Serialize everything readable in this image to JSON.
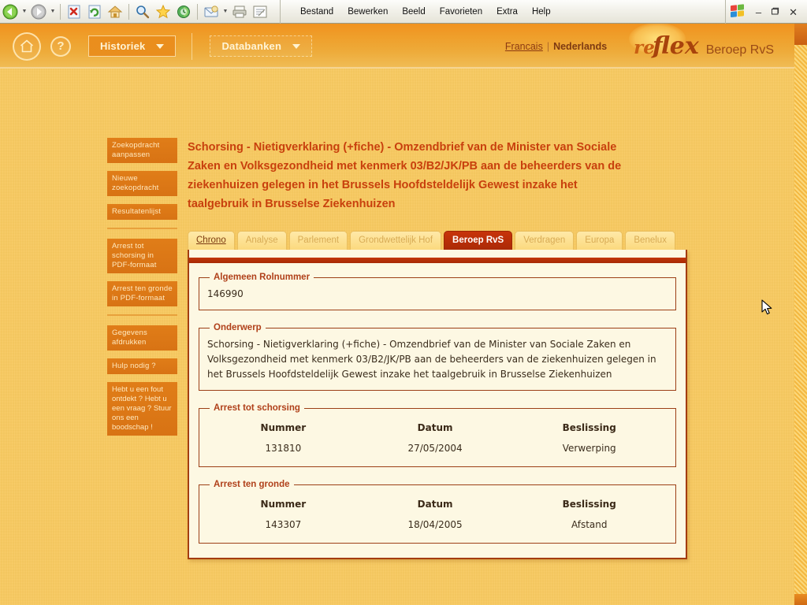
{
  "browser": {
    "toolbar_buttons": [
      {
        "name": "back-button",
        "icon": "back-arrow-icon",
        "label": "Back"
      },
      {
        "name": "forward-button",
        "icon": "forward-arrow-icon",
        "label": "Forward"
      },
      {
        "name": "stop-button",
        "icon": "stop-icon",
        "label": "Stop"
      },
      {
        "name": "refresh-button",
        "icon": "refresh-icon",
        "label": "Refresh"
      },
      {
        "name": "home-button",
        "icon": "house-icon",
        "label": "Home"
      },
      {
        "name": "search-button",
        "icon": "magnifier-icon",
        "label": "Search"
      },
      {
        "name": "favorites-button",
        "icon": "star-icon",
        "label": "Favorites"
      },
      {
        "name": "history-button",
        "icon": "globe-clock-icon",
        "label": "History"
      },
      {
        "name": "mail-button",
        "icon": "envelope-icon",
        "label": "Mail"
      },
      {
        "name": "print-button",
        "icon": "printer-icon",
        "label": "Print"
      },
      {
        "name": "edit-button",
        "icon": "document-edit-icon",
        "label": "Edit"
      }
    ],
    "menu": [
      "Bestand",
      "Bewerken",
      "Beeld",
      "Favorieten",
      "Extra",
      "Help"
    ],
    "window_controls": {
      "minimize": "–",
      "restore": "❐",
      "close": "✕"
    }
  },
  "header": {
    "home_label": "Home",
    "help_label": "?",
    "buttons": [
      {
        "label": "Historiek",
        "name": "historiek-dropdown"
      },
      {
        "label": "Databanken",
        "name": "databanken-dropdown"
      }
    ],
    "languages": {
      "other": "Francais",
      "separator": "|",
      "current": "Nederlands"
    },
    "brand": {
      "part1": "re",
      "part2": "flex",
      "subtitle": "Beroep RvS"
    }
  },
  "sidebar": {
    "items": [
      {
        "label": "Zoekopdracht aanpassen",
        "name": "sidebar-item-adjust-search"
      },
      {
        "label": "Nieuwe zoekopdracht",
        "name": "sidebar-item-new-search"
      },
      {
        "label": "Resultatenlijst",
        "name": "sidebar-item-results-list"
      }
    ],
    "pdf_items": [
      {
        "label": "Arrest tot schorsing in PDF-formaat",
        "name": "sidebar-item-pdf-suspension"
      },
      {
        "label": "Arrest ten gronde in PDF-formaat",
        "name": "sidebar-item-pdf-merits"
      }
    ],
    "tools": [
      {
        "label": "Gegevens afdrukken",
        "name": "sidebar-item-print-data"
      },
      {
        "label": "Hulp nodig ?",
        "name": "sidebar-item-help"
      }
    ],
    "message_box": "Hebt u een fout ontdekt ? Hebt u een vraag ? Stuur ons een boodschap !"
  },
  "main": {
    "page_title": "Schorsing - Nietigverklaring (+fiche) - Omzendbrief van de Minister van Sociale Zaken en Volksgezondheid met kenmerk 03/B2/JK/PB aan de beheerders van de ziekenhuizen gelegen in het Brussels Hoofdsteldelijk Gewest inzake het taalgebruik in Brusselse Ziekenhuizen",
    "tabs": [
      {
        "label": "Chrono",
        "active": false,
        "style": "chrono"
      },
      {
        "label": "Analyse",
        "active": false,
        "style": "dim"
      },
      {
        "label": "Parlement",
        "active": false,
        "style": "dim"
      },
      {
        "label": "Grondwettelijk Hof",
        "active": false,
        "style": "dim"
      },
      {
        "label": "Beroep RvS",
        "active": true,
        "style": "active"
      },
      {
        "label": "Verdragen",
        "active": false,
        "style": "dim"
      },
      {
        "label": "Europa",
        "active": false,
        "style": "dim"
      },
      {
        "label": "Benelux",
        "active": false,
        "style": "dim"
      }
    ],
    "rolnummer": {
      "legend": "Algemeen Rolnummer",
      "value": "146990"
    },
    "onderwerp": {
      "legend": "Onderwerp",
      "value": "Schorsing - Nietigverklaring (+fiche) - Omzendbrief van de Minister van Sociale Zaken en Volksgezondheid met kenmerk 03/B2/JK/PB aan de beheerders van de ziekenhuizen gelegen in het Brussels Hoofdsteldelijk Gewest inzake het taalgebruik in Brusselse Ziekenhuizen"
    },
    "arrest_schorsing": {
      "legend": "Arrest tot schorsing",
      "columns": [
        "Nummer",
        "Datum",
        "Beslissing"
      ],
      "rows": [
        [
          "131810",
          "27/05/2004",
          "Verwerping"
        ]
      ]
    },
    "arrest_gronde": {
      "legend": "Arrest ten gronde",
      "columns": [
        "Nummer",
        "Datum",
        "Beslissing"
      ],
      "rows": [
        [
          "143307",
          "18/04/2005",
          "Afstand"
        ]
      ]
    }
  },
  "colors": {
    "page_bg": "#f9c95e",
    "header_orange": "#ef9f2b",
    "accent_red": "#c8400d",
    "active_tab": "#b82d07",
    "panel_bg": "#fdf8e3",
    "sidebar_button": "#dd7a16"
  }
}
